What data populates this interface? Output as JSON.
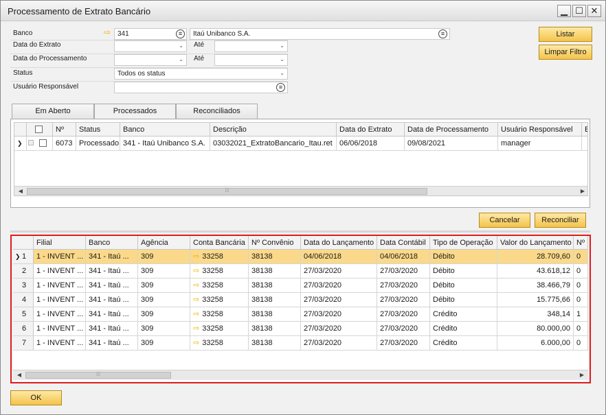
{
  "window": {
    "title": "Processamento de Extrato Bancário",
    "minimize": "▁",
    "maximize": "☐",
    "close": "✕"
  },
  "form": {
    "banco_label": "Banco",
    "banco_code": "341",
    "banco_name": "Itaú Unibanco  S.A.",
    "data_extrato_label": "Data do Extrato",
    "data_processamento_label": "Data do Processamento",
    "ate_label": "Até",
    "status_label": "Status",
    "status_value": "Todos os status",
    "usuario_label": "Usuário Responsável",
    "usuario_value": ""
  },
  "buttons": {
    "listar": "Listar",
    "limpar_filtro": "Limpar Filtro",
    "cancelar": "Cancelar",
    "reconciliar": "Reconciliar",
    "ok": "OK"
  },
  "tabs": [
    "Em Aberto",
    "Processados",
    "Reconciliados"
  ],
  "active_tab": "Processados",
  "top_grid": {
    "headers": [
      "Nº",
      "Status",
      "Banco",
      "Descrição",
      "Data do Extrato",
      "Data de Processamento",
      "Usuário Responsável",
      "E"
    ],
    "rows": [
      [
        "6073",
        "Processado",
        "341 - Itaú Unibanco  S.A.",
        "03032021_ExtratoBancario_Itau.ret",
        "06/06/2018",
        "09/08/2021",
        "manager",
        ""
      ]
    ]
  },
  "bottom_grid": {
    "headers": [
      "Filial",
      "Banco",
      "Agência",
      "Conta Bancária",
      "Nº Convênio",
      "Data do Lançamento",
      "Data Contábil",
      "Tipo de Operação",
      "Valor do Lançamento",
      "Nº"
    ],
    "rows": [
      [
        "1",
        "1 - INVENT ...",
        "341 - Itaú ...",
        "309",
        "33258",
        "38138",
        "04/06/2018",
        "04/06/2018",
        "Débito",
        "28.709,60",
        "0"
      ],
      [
        "2",
        "1 - INVENT ...",
        "341 - Itaú ...",
        "309",
        "33258",
        "38138",
        "27/03/2020",
        "27/03/2020",
        "Débito",
        "43.618,12",
        "0"
      ],
      [
        "3",
        "1 - INVENT ...",
        "341 - Itaú ...",
        "309",
        "33258",
        "38138",
        "27/03/2020",
        "27/03/2020",
        "Débito",
        "38.466,79",
        "0"
      ],
      [
        "4",
        "1 - INVENT ...",
        "341 - Itaú ...",
        "309",
        "33258",
        "38138",
        "27/03/2020",
        "27/03/2020",
        "Débito",
        "15.775,66",
        "0"
      ],
      [
        "5",
        "1 - INVENT ...",
        "341 - Itaú ...",
        "309",
        "33258",
        "38138",
        "27/03/2020",
        "27/03/2020",
        "Crédito",
        "348,14",
        "1"
      ],
      [
        "6",
        "1 - INVENT ...",
        "341 - Itaú ...",
        "309",
        "33258",
        "38138",
        "27/03/2020",
        "27/03/2020",
        "Crédito",
        "80.000,00",
        "0"
      ],
      [
        "7",
        "1 - INVENT ...",
        "341 - Itaú ...",
        "309",
        "33258",
        "38138",
        "27/03/2020",
        "27/03/2020",
        "Crédito",
        "6.000,00",
        "0"
      ]
    ],
    "selected_row": 0
  },
  "colors": {
    "accent_button": "#f4c44a",
    "selected_row": "#fbd98a",
    "highlight_border": "#e01b1b",
    "link_arrow": "#f2b200"
  },
  "icons": {
    "link_arrow": "⇨",
    "row_marker": "❯",
    "list_button": "≡",
    "dropdown": "⌄"
  }
}
